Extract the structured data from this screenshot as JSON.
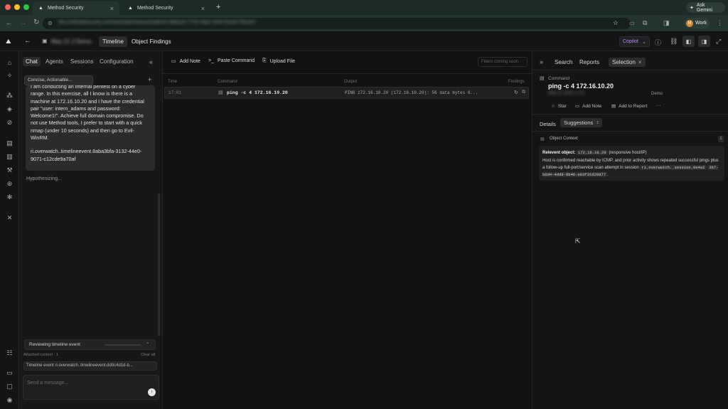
{
  "browser": {
    "tabs": [
      {
        "title": "Method Security"
      },
      {
        "title": "Method Security"
      }
    ],
    "new_tab": "+",
    "ask": "Ask Gemini",
    "url": "dev.methodsecurity.com/overwatch/session/demo-8d3a1b-7742-4ab1-9c0f-61b2e7f9c3e2",
    "profile": "Work",
    "profile_initial": "M"
  },
  "app": {
    "title": "May 21 2 Demo",
    "views": {
      "timeline": "Timeline",
      "findings": "Object Findings"
    },
    "copilot": "Copilot"
  },
  "chat": {
    "tabs": [
      "Chat",
      "Agents",
      "Sessions",
      "Configuration"
    ],
    "collapse": "«",
    "mode": "Concise, Actionable...",
    "add": "+",
    "message_lines": [
      "I am conducting an internal pentest on a cyber range. In this exercise, all I know is there is a machine at 172.16.10.20 and I have the credential pair \"user: intern_adams and password: Welcome1!\". Achieve full domain compromise. Do not use Method tools, I prefer to start with a quick nmap (under 10 seconds) and then go to Evil-WinRM.",
      "ri.overwatch..timelineevent.8aba3bfa-3132-44e0-9071-c12cde9a70af"
    ],
    "status": "Hypothesizing...",
    "reviewing": "Reviewing timeline event",
    "attached": "Attached context · 1",
    "clear": "Clear all",
    "chip": "Timeline event ri.overwatch..timelineevent.dd0c4d1d-b...",
    "placeholder": "Send a message..."
  },
  "timeline": {
    "toolbar": {
      "note": "Add Note",
      "paste": "Paste Command",
      "upload": "Upload File",
      "filter": "Filters coming soon"
    },
    "columns": [
      "Time",
      "Command",
      "Output",
      "Findings"
    ],
    "rows": [
      {
        "time": "17:01",
        "command": "ping -c 4 172.16.10.20",
        "output": "PING 172.16.10.20 (172.16.10.20): 56 data bytes 6..."
      }
    ]
  },
  "detail": {
    "tabs": [
      "Search",
      "Reports",
      "Selection"
    ],
    "expand": "»",
    "kind": "Command",
    "title": "ping -c 4 172.16.10.20",
    "meta": "May 21 2025 17:01",
    "demo": "Demo",
    "actions": [
      "Star",
      "Add Note",
      "Add to Report",
      "···"
    ],
    "subtabs": [
      "Details",
      "Suggestions"
    ],
    "suggestion_count": "1",
    "object_context": "Object Context",
    "ctx_count": "1",
    "relevant_label": "Relevent object:",
    "relevant_ip": "172.16.10.20",
    "relevant_note": "(responsive host/IP)",
    "ctx_text": "Host is confirmed reachable by ICMP, and prior activity shows repeated successful pings plus a follow-up full-port/service scan attempt in session",
    "ctx_session": "ri.overwatch..session.0e4a2",
    "ctx_session2": "3b7-b6d4-4dd8-8b46-e83f31d29877",
    "ctx_end": "."
  },
  "colors": {
    "accent_purple": "#b18cff",
    "page_bg": "#111213"
  }
}
